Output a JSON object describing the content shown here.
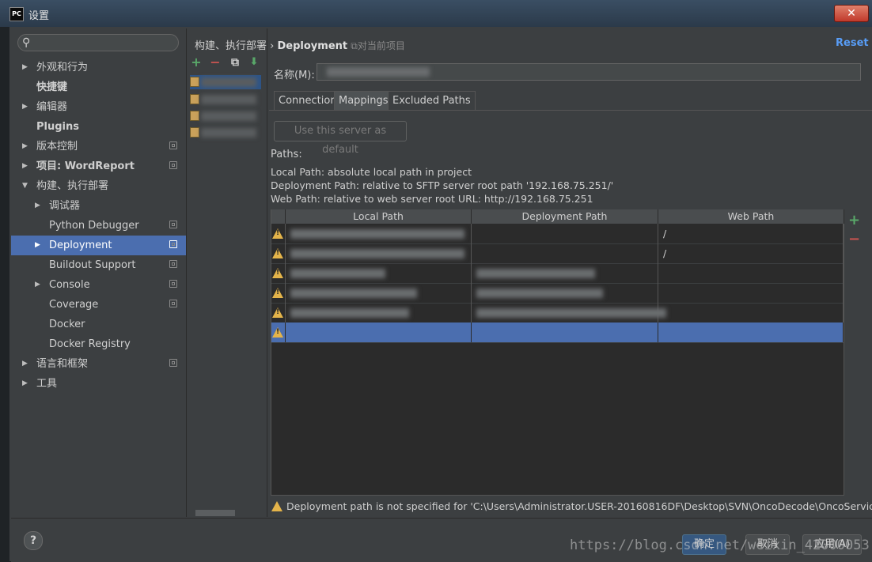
{
  "window": {
    "title": "设置",
    "app_icon": "PC",
    "close": "✕"
  },
  "search": {
    "placeholder": ""
  },
  "sidebar": {
    "items": [
      {
        "label": "外观和行为",
        "arrow": "▶"
      },
      {
        "label": "快捷键"
      },
      {
        "label": "编辑器",
        "arrow": "▶"
      },
      {
        "label": "Plugins"
      },
      {
        "label": "版本控制",
        "arrow": "▶"
      },
      {
        "label": "项目: WordReport",
        "arrow": "▶"
      },
      {
        "label": "构建、执行部署",
        "arrow": "▼"
      },
      {
        "label": "调试器",
        "arrow": "▶"
      },
      {
        "label": "Python Debugger"
      },
      {
        "label": "Deployment",
        "arrow": "▶"
      },
      {
        "label": "Buildout Support"
      },
      {
        "label": "Console",
        "arrow": "▶"
      },
      {
        "label": "Coverage"
      },
      {
        "label": "Docker"
      },
      {
        "label": "Docker Registry"
      },
      {
        "label": "语言和框架",
        "arrow": "▶"
      },
      {
        "label": "工具",
        "arrow": "▶"
      }
    ]
  },
  "toolbar": {
    "add": "+",
    "remove": "−",
    "copy": "⧉",
    "default": "⬇"
  },
  "breadcrumb": {
    "parent": "构建、执行部署",
    "separator": "›",
    "current": "Deployment",
    "scope_icon": "⧉",
    "scope": "对当前项目"
  },
  "reset_label": "Reset",
  "name_label": "名称(M):",
  "tabs": [
    "Connection",
    "Mappings",
    "Excluded Paths"
  ],
  "default_button": "Use this server as default",
  "paths_label": "Paths:",
  "info": {
    "local": "Local Path: absolute local path in project",
    "deployment": "Deployment Path: relative to SFTP server root path '192.168.75.251/'",
    "web": "Web Path: relative to web server root URL: http://192.168.75.251"
  },
  "table": {
    "headers": [
      "Local Path",
      "Deployment Path",
      "Web Path"
    ],
    "rows": [
      {
        "web": "/"
      },
      {
        "web": "/"
      },
      {
        "web": ""
      },
      {
        "web": ""
      },
      {
        "web": ""
      },
      {
        "web": ""
      }
    ],
    "add": "+",
    "remove": "−"
  },
  "status_message": "Deployment path is not specified for 'C:\\Users\\Administrator.USER-20160816DF\\Desktop\\SVN\\OncoDecode\\OncoService'.",
  "dialog_buttons": {
    "help": "?",
    "ok": "确定",
    "cancel": "取消",
    "apply": "应用(A)"
  },
  "watermark": "https://blog.csdn.net/weixin_42000053",
  "colors": {
    "selection": "#4b6eaf",
    "link": "#589df6",
    "warning": "#e4b44a",
    "add": "#59a869",
    "remove": "#c75450"
  }
}
